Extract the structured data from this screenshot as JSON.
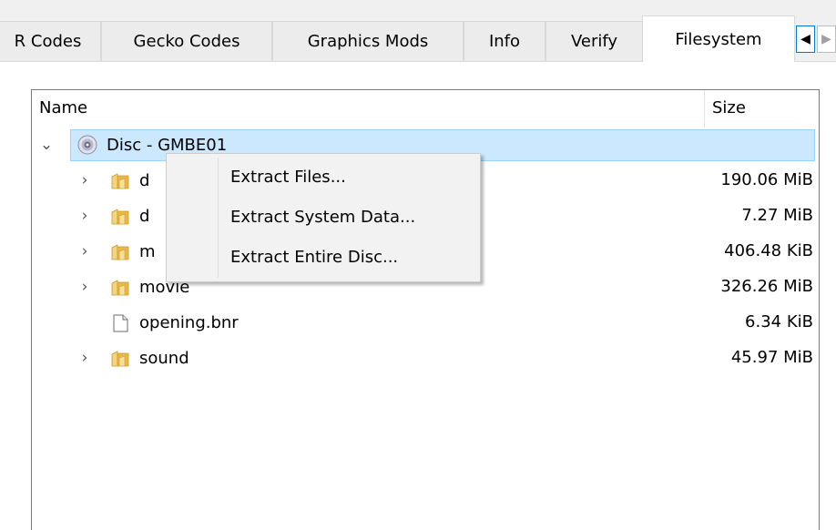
{
  "tabs": [
    {
      "label": "R Codes",
      "active": false
    },
    {
      "label": "Gecko Codes",
      "active": false
    },
    {
      "label": "Graphics Mods",
      "active": false
    },
    {
      "label": "Info",
      "active": false
    },
    {
      "label": "Verify",
      "active": false
    },
    {
      "label": "Filesystem",
      "active": true
    }
  ],
  "tab_scroll": {
    "left_glyph": "◀",
    "right_glyph": "▶"
  },
  "tree": {
    "columns": {
      "name": "Name",
      "size": "Size"
    },
    "root": {
      "label": "Disc - GMBE01",
      "expander": "⌄",
      "icon": "disc-icon"
    },
    "rows": [
      {
        "label": "d",
        "size": "190.06 MiB",
        "icon": "folder-icon",
        "expander": "›"
      },
      {
        "label": "d",
        "size": "7.27 MiB",
        "icon": "folder-icon",
        "expander": "›"
      },
      {
        "label": "m",
        "size": "406.48 KiB",
        "icon": "folder-icon",
        "expander": "›"
      },
      {
        "label": "movie",
        "size": "326.26 MiB",
        "icon": "folder-icon",
        "expander": "›"
      },
      {
        "label": "opening.bnr",
        "size": "6.34 KiB",
        "icon": "file-icon",
        "expander": ""
      },
      {
        "label": "sound",
        "size": "45.97 MiB",
        "icon": "folder-icon",
        "expander": "›"
      }
    ]
  },
  "context_menu": {
    "items": [
      {
        "label": "Extract Files..."
      },
      {
        "label": "Extract System Data..."
      },
      {
        "label": "Extract Entire Disc..."
      }
    ]
  },
  "colors": {
    "selection_fill": "#cce8ff",
    "selection_border": "#99d1ff",
    "folder": "#e8b84a",
    "active_scroll_border": "#0078d7"
  }
}
